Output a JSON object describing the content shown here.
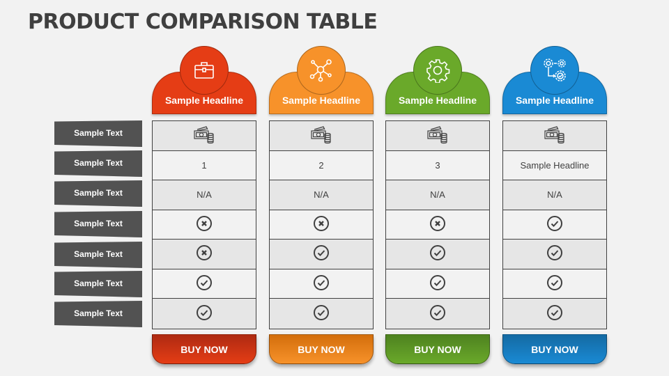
{
  "title": "PRODUCT COMPARISON TABLE",
  "row_labels": [
    "Sample Text",
    "Sample Text",
    "Sample Text",
    "Sample Text",
    "Sample Text",
    "Sample Text",
    "Sample Text"
  ],
  "columns": [
    {
      "headline": "Sample Headline",
      "icon": "briefcase-icon",
      "color": "#e53d15",
      "cells": [
        "money-icon",
        "1",
        "N/A",
        "cross",
        "cross",
        "check",
        "check"
      ],
      "button": "BUY NOW"
    },
    {
      "headline": "Sample Headline",
      "icon": "network-icon",
      "color": "#f7922a",
      "cells": [
        "money-icon",
        "2",
        "N/A",
        "cross",
        "check",
        "check",
        "check"
      ],
      "button": "BUY NOW"
    },
    {
      "headline": "Sample Headline",
      "icon": "gear-icon",
      "color": "#6aa92a",
      "cells": [
        "money-icon",
        "3",
        "N/A",
        "cross",
        "check",
        "check",
        "check"
      ],
      "button": "BUY NOW"
    },
    {
      "headline": "Sample Headline",
      "icon": "process-gears-icon",
      "color": "#1a8ad4",
      "cells": [
        "money-icon",
        "Sample Headline",
        "N/A",
        "check",
        "check",
        "check",
        "check"
      ],
      "button": "BUY NOW"
    }
  ]
}
